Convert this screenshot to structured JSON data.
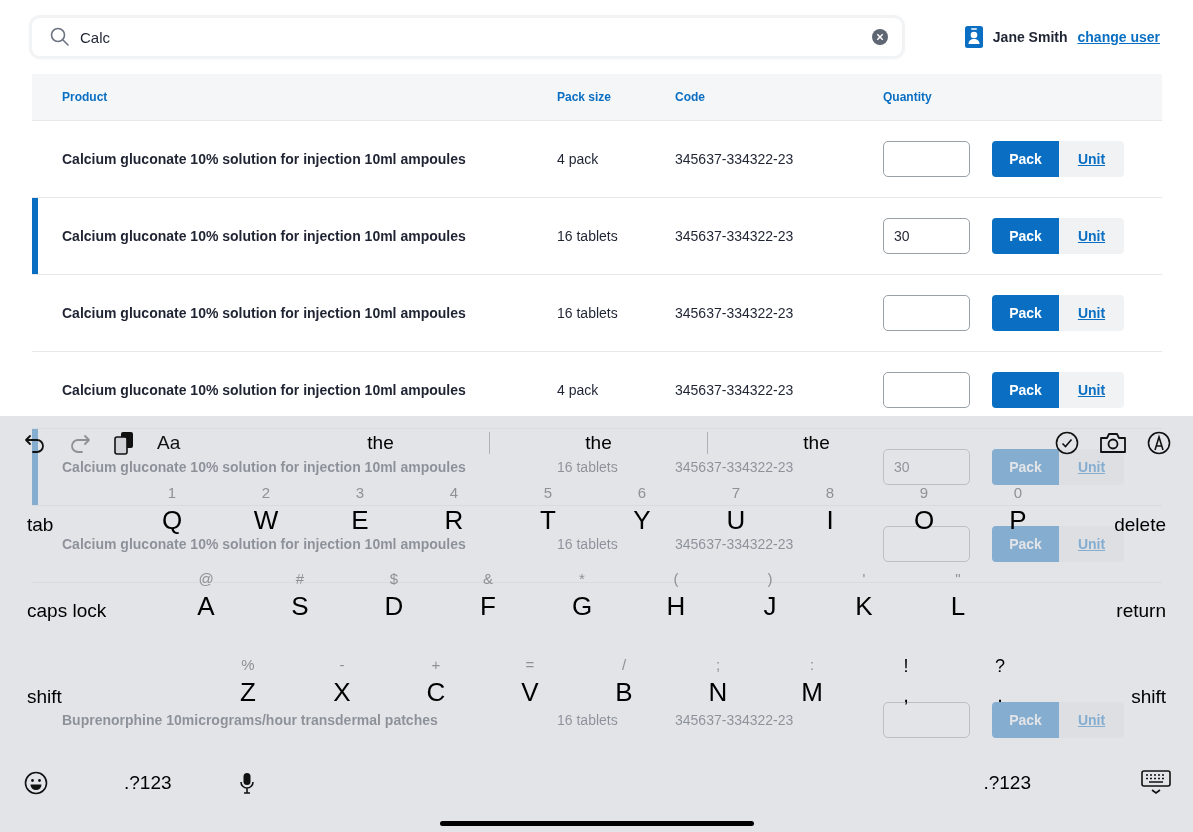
{
  "search": {
    "value": "Calc"
  },
  "user": {
    "name": "Jane Smith",
    "link": "change user"
  },
  "table": {
    "columns": [
      "Product",
      "Pack size",
      "Code",
      "Quantity"
    ],
    "rows": [
      {
        "product": "Calcium gluconate 10% solution for injection 10ml ampoules",
        "pack_size": "4 pack",
        "code": "345637-334322-23",
        "selected": false,
        "toggle": [
          {
            "label": "Pack",
            "selected": true
          },
          {
            "label": "Unit",
            "selected": false
          }
        ]
      },
      {
        "product": "Calcium gluconate 10% solution for injection 10ml ampoules",
        "pack_size": "16 tablets",
        "code": "345637-334322-23",
        "quantity": "30",
        "selected": true,
        "toggle": [
          {
            "label": "Pack",
            "selected": true
          },
          {
            "label": "Unit",
            "selected": false
          }
        ]
      },
      {
        "product": "Calcium gluconate 10% solution for injection 10ml ampoules",
        "pack_size": "16 tablets",
        "code": "345637-334322-23",
        "selected": false,
        "toggle": [
          {
            "label": "Pack",
            "selected": true
          },
          {
            "label": "Unit",
            "selected": false
          }
        ]
      },
      {
        "product": "Calcium gluconate 10% solution for injection 10ml ampoules",
        "pack_size": "4 pack",
        "code": "345637-334322-23",
        "selected": false,
        "toggle": [
          {
            "label": "Pack",
            "selected": true
          },
          {
            "label": "Unit",
            "selected": false
          }
        ]
      },
      {
        "product": "Calcium gluconate 10% solution for injection 10ml ampoules",
        "pack_size": "16 tablets",
        "code": "345637-334322-23",
        "quantity": "30",
        "selected": true,
        "toggle": [
          {
            "label": "Pack",
            "selected": true
          },
          {
            "label": "Unit",
            "selected": false
          }
        ]
      },
      {
        "product": "Calcium gluconate 10% solution for injection 10ml ampoules",
        "pack_size": "16 tablets",
        "code": "345637-334322-23",
        "selected": false,
        "toggle": [
          {
            "label": "Pack",
            "selected": true
          },
          {
            "label": "Unit",
            "selected": false
          }
        ]
      },
      {
        "product": "Buprenorphine 10micrograms/hour transdermal patches",
        "pack_size": "16 tablets",
        "code": "345637-334322-23",
        "selected": false,
        "toggle": [
          {
            "label": "Pack",
            "selected": true
          },
          {
            "label": "Unit",
            "selected": false
          }
        ]
      }
    ]
  },
  "keyboard": {
    "toolbar": {
      "undo_enabled": true,
      "redo_enabled": false,
      "format": "Aa",
      "suggestions": [
        "the",
        "the",
        "the"
      ]
    },
    "rows": [
      {
        "left": "tab",
        "right": "delete",
        "keys": [
          {
            "main": "Q",
            "alt": "1",
            "kind": "letter"
          },
          {
            "main": "W",
            "alt": "2",
            "kind": "letter"
          },
          {
            "main": "E",
            "alt": "3",
            "kind": "letter"
          },
          {
            "main": "R",
            "alt": "4",
            "kind": "letter"
          },
          {
            "main": "T",
            "alt": "5",
            "kind": "letter"
          },
          {
            "main": "Y",
            "alt": "6",
            "kind": "letter"
          },
          {
            "main": "U",
            "alt": "7",
            "kind": "letter"
          },
          {
            "main": "I",
            "alt": "8",
            "kind": "letter"
          },
          {
            "main": "O",
            "alt": "9",
            "kind": "letter"
          },
          {
            "main": "P",
            "alt": "0",
            "kind": "letter"
          }
        ]
      },
      {
        "left": "caps lock",
        "right": "return",
        "keys": [
          {
            "main": "A",
            "alt": "@",
            "kind": "letter"
          },
          {
            "main": "S",
            "alt": "#",
            "kind": "letter"
          },
          {
            "main": "D",
            "alt": "$",
            "kind": "letter"
          },
          {
            "main": "F",
            "alt": "&",
            "kind": "letter"
          },
          {
            "main": "G",
            "alt": "*",
            "kind": "letter"
          },
          {
            "main": "H",
            "alt": "(",
            "kind": "letter"
          },
          {
            "main": "J",
            "alt": ")",
            "kind": "letter"
          },
          {
            "main": "K",
            "alt": "'",
            "kind": "letter"
          },
          {
            "main": "L",
            "alt": "\"",
            "kind": "letter"
          }
        ]
      },
      {
        "left": "shift",
        "right": "shift",
        "keys": [
          {
            "main": "Z",
            "alt": "%",
            "kind": "letter"
          },
          {
            "main": "X",
            "alt": "-",
            "kind": "letter"
          },
          {
            "main": "C",
            "alt": "+",
            "kind": "letter"
          },
          {
            "main": "V",
            "alt": "=",
            "kind": "letter"
          },
          {
            "main": "B",
            "alt": "/",
            "kind": "letter"
          },
          {
            "main": "N",
            "alt": ";",
            "kind": "letter"
          },
          {
            "main": "M",
            "alt": ":",
            "kind": "letter"
          },
          {
            "main": ",",
            "alt": "!",
            "kind": "punct"
          },
          {
            "main": ".",
            "alt": "?",
            "kind": "punct"
          }
        ]
      }
    ],
    "bottom": {
      "left_mode": ".?123",
      "right_mode": ".?123"
    }
  }
}
